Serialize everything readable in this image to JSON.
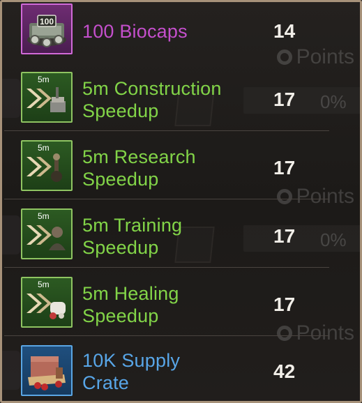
{
  "items": [
    {
      "name": "100 Biocaps",
      "qty": "14",
      "rarity": "purple",
      "badge": "",
      "icon": "biocaps-icon"
    },
    {
      "name_line1": "5m Construction",
      "name_line2": "Speedup",
      "qty": "17",
      "rarity": "green",
      "badge": "5m",
      "icon": "construction-speedup-icon"
    },
    {
      "name_line1": "5m Research",
      "name_line2": "Speedup",
      "qty": "17",
      "rarity": "green",
      "badge": "5m",
      "icon": "research-speedup-icon"
    },
    {
      "name_line1": "5m Training",
      "name_line2": "Speedup",
      "qty": "17",
      "rarity": "green",
      "badge": "5m",
      "icon": "training-speedup-icon"
    },
    {
      "name_line1": "5m Healing",
      "name_line2": "Speedup",
      "qty": "17",
      "rarity": "green",
      "badge": "5m",
      "icon": "healing-speedup-icon"
    },
    {
      "name_line1": "10K Supply",
      "name_line2": "Crate",
      "qty": "42",
      "rarity": "blue",
      "badge": "",
      "icon": "supply-crate-icon"
    }
  ],
  "background": {
    "points_label": "Points",
    "progress_label": "0%"
  },
  "colors": {
    "green": "#82d448",
    "purple": "#c44fcc",
    "blue": "#58a6e8",
    "frame": "#a7927a"
  }
}
